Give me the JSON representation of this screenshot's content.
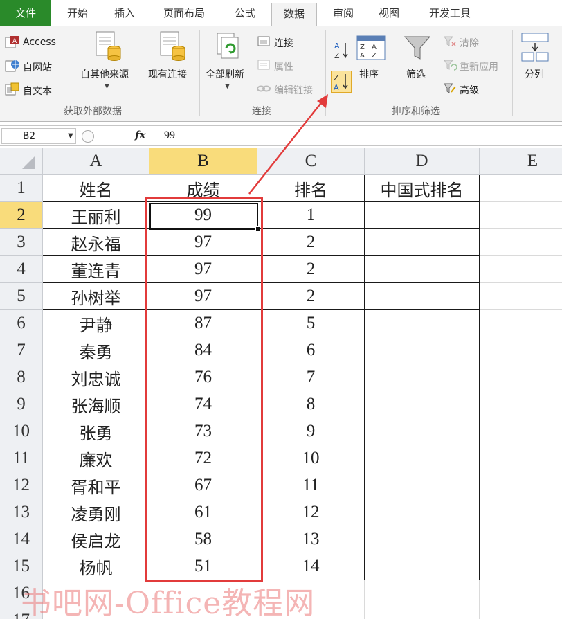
{
  "tabs": [
    {
      "label": "文件"
    },
    {
      "label": "开始"
    },
    {
      "label": "插入"
    },
    {
      "label": "页面布局"
    },
    {
      "label": "公式"
    },
    {
      "label": "数据"
    },
    {
      "label": "审阅"
    },
    {
      "label": "视图"
    },
    {
      "label": "开发工具"
    }
  ],
  "active_tab": "数据",
  "ribbon": {
    "get_external": {
      "access": "Access",
      "web": "自网站",
      "text": "自文本",
      "other_sources": "自其他来源",
      "existing_connections": "现有连接",
      "group_label": "获取外部数据"
    },
    "connections": {
      "refresh_all": "全部刷新",
      "connections": "连接",
      "properties": "属性",
      "edit_links": "编辑链接",
      "group_label": "连接"
    },
    "sort_filter": {
      "sort": "排序",
      "filter": "筛选",
      "clear": "清除",
      "reapply": "重新应用",
      "advanced": "高级",
      "group_label": "排序和筛选"
    },
    "data_tools": {
      "text_to_columns": "分列"
    }
  },
  "formula_bar": {
    "name_box": "B2",
    "fx_label": "fx",
    "value": "99"
  },
  "grid": {
    "columns": [
      "A",
      "B",
      "C",
      "D",
      "E"
    ],
    "selected_column": "B",
    "row_numbers": [
      "1",
      "2",
      "3",
      "4",
      "5",
      "6",
      "7",
      "8",
      "9",
      "10",
      "11",
      "12",
      "13",
      "14",
      "15",
      "16",
      "17"
    ],
    "selected_row": "2",
    "header_row": [
      "姓名",
      "成绩",
      "排名",
      "中国式排名"
    ],
    "rows": [
      [
        "王丽利",
        "99",
        "1",
        ""
      ],
      [
        "赵永福",
        "97",
        "2",
        ""
      ],
      [
        "董连青",
        "97",
        "2",
        ""
      ],
      [
        "孙树举",
        "97",
        "2",
        ""
      ],
      [
        "尹静",
        "87",
        "5",
        ""
      ],
      [
        "秦勇",
        "84",
        "6",
        ""
      ],
      [
        "刘忠诚",
        "76",
        "7",
        ""
      ],
      [
        "张海顺",
        "74",
        "8",
        ""
      ],
      [
        "张勇",
        "73",
        "9",
        ""
      ],
      [
        "廉欢",
        "72",
        "10",
        ""
      ],
      [
        "胥和平",
        "67",
        "11",
        ""
      ],
      [
        "凌勇刚",
        "61",
        "12",
        ""
      ],
      [
        "侯启龙",
        "58",
        "13",
        ""
      ],
      [
        "杨帆",
        "51",
        "14",
        ""
      ]
    ]
  },
  "annotation_color": "#e23b3b",
  "accent_colors": {
    "file_tab": "#2a8a2a",
    "selected_header": "#f9dc7b"
  },
  "watermark": "书吧网-Office教程网"
}
